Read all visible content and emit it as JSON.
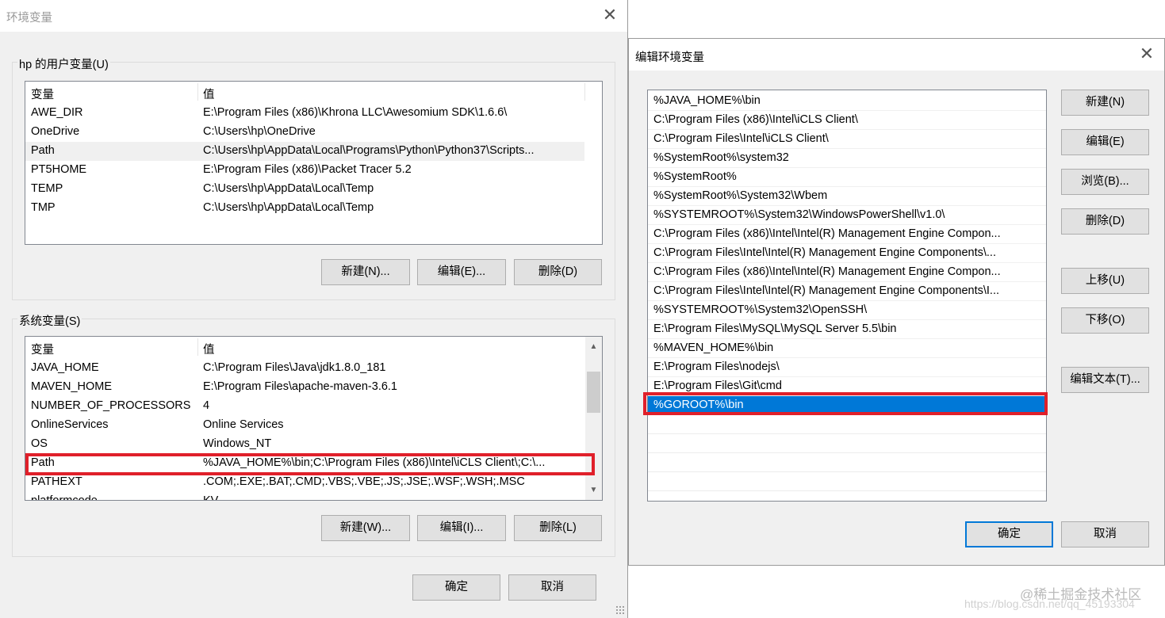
{
  "env_dialog": {
    "title": "环境变量",
    "user_group_label": "hp 的用户变量(U)",
    "user_vars": {
      "headers": [
        "变量",
        "值"
      ],
      "rows": [
        {
          "name": "AWE_DIR",
          "value": "E:\\Program Files (x86)\\Khrona LLC\\Awesomium SDK\\1.6.6\\"
        },
        {
          "name": "OneDrive",
          "value": "C:\\Users\\hp\\OneDrive"
        },
        {
          "name": "Path",
          "value": "C:\\Users\\hp\\AppData\\Local\\Programs\\Python\\Python37\\Scripts..."
        },
        {
          "name": "PT5HOME",
          "value": "E:\\Program Files (x86)\\Packet Tracer 5.2"
        },
        {
          "name": "TEMP",
          "value": "C:\\Users\\hp\\AppData\\Local\\Temp"
        },
        {
          "name": "TMP",
          "value": "C:\\Users\\hp\\AppData\\Local\\Temp"
        }
      ],
      "selected_row": "Path"
    },
    "user_buttons": {
      "new": "新建(N)...",
      "edit": "编辑(E)...",
      "delete": "删除(D)"
    },
    "system_group_label": "系统变量(S)",
    "system_vars": {
      "headers": [
        "变量",
        "值"
      ],
      "rows": [
        {
          "name": "JAVA_HOME",
          "value": "C:\\Program Files\\Java\\jdk1.8.0_181"
        },
        {
          "name": "MAVEN_HOME",
          "value": "E:\\Program Files\\apache-maven-3.6.1"
        },
        {
          "name": "NUMBER_OF_PROCESSORS",
          "value": "4"
        },
        {
          "name": "OnlineServices",
          "value": "Online Services"
        },
        {
          "name": "OS",
          "value": "Windows_NT"
        },
        {
          "name": "Path",
          "value": "%JAVA_HOME%\\bin;C:\\Program Files (x86)\\Intel\\iCLS Client\\;C:\\..."
        },
        {
          "name": "PATHEXT",
          "value": ".COM;.EXE;.BAT;.CMD;.VBS;.VBE;.JS;.JSE;.WSF;.WSH;.MSC"
        },
        {
          "name": "platformcode",
          "value": "KV"
        }
      ],
      "highlighted_row": "Path"
    },
    "system_buttons": {
      "new": "新建(W)...",
      "edit": "编辑(I)...",
      "delete": "删除(L)"
    },
    "ok": "确定",
    "cancel": "取消"
  },
  "edit_dialog": {
    "title": "编辑环境变量",
    "entries": [
      "%JAVA_HOME%\\bin",
      "C:\\Program Files (x86)\\Intel\\iCLS Client\\",
      "C:\\Program Files\\Intel\\iCLS Client\\",
      "%SystemRoot%\\system32",
      "%SystemRoot%",
      "%SystemRoot%\\System32\\Wbem",
      "%SYSTEMROOT%\\System32\\WindowsPowerShell\\v1.0\\",
      "C:\\Program Files (x86)\\Intel\\Intel(R) Management Engine Compon...",
      "C:\\Program Files\\Intel\\Intel(R) Management Engine Components\\...",
      "C:\\Program Files (x86)\\Intel\\Intel(R) Management Engine Compon...",
      "C:\\Program Files\\Intel\\Intel(R) Management Engine Components\\I...",
      "%SYSTEMROOT%\\System32\\OpenSSH\\",
      "E:\\Program Files\\MySQL\\MySQL Server 5.5\\bin",
      "%MAVEN_HOME%\\bin",
      "E:\\Program Files\\nodejs\\",
      "E:\\Program Files\\Git\\cmd",
      "%GOROOT%\\bin"
    ],
    "selected_entry": "%GOROOT%\\bin",
    "buttons": {
      "new": "新建(N)",
      "edit": "编辑(E)",
      "browse": "浏览(B)...",
      "delete": "删除(D)",
      "move_up": "上移(U)",
      "move_down": "下移(O)",
      "edit_text": "编辑文本(T)..."
    },
    "ok": "确定",
    "cancel": "取消"
  },
  "watermark": {
    "line1": "@稀土掘金技术社区",
    "line2": "https://blog.csdn.net/qq_45193304"
  },
  "colors": {
    "selection": "#0078d7",
    "highlight_box": "#e0202a",
    "dialog_bg": "#f0f0f0"
  }
}
